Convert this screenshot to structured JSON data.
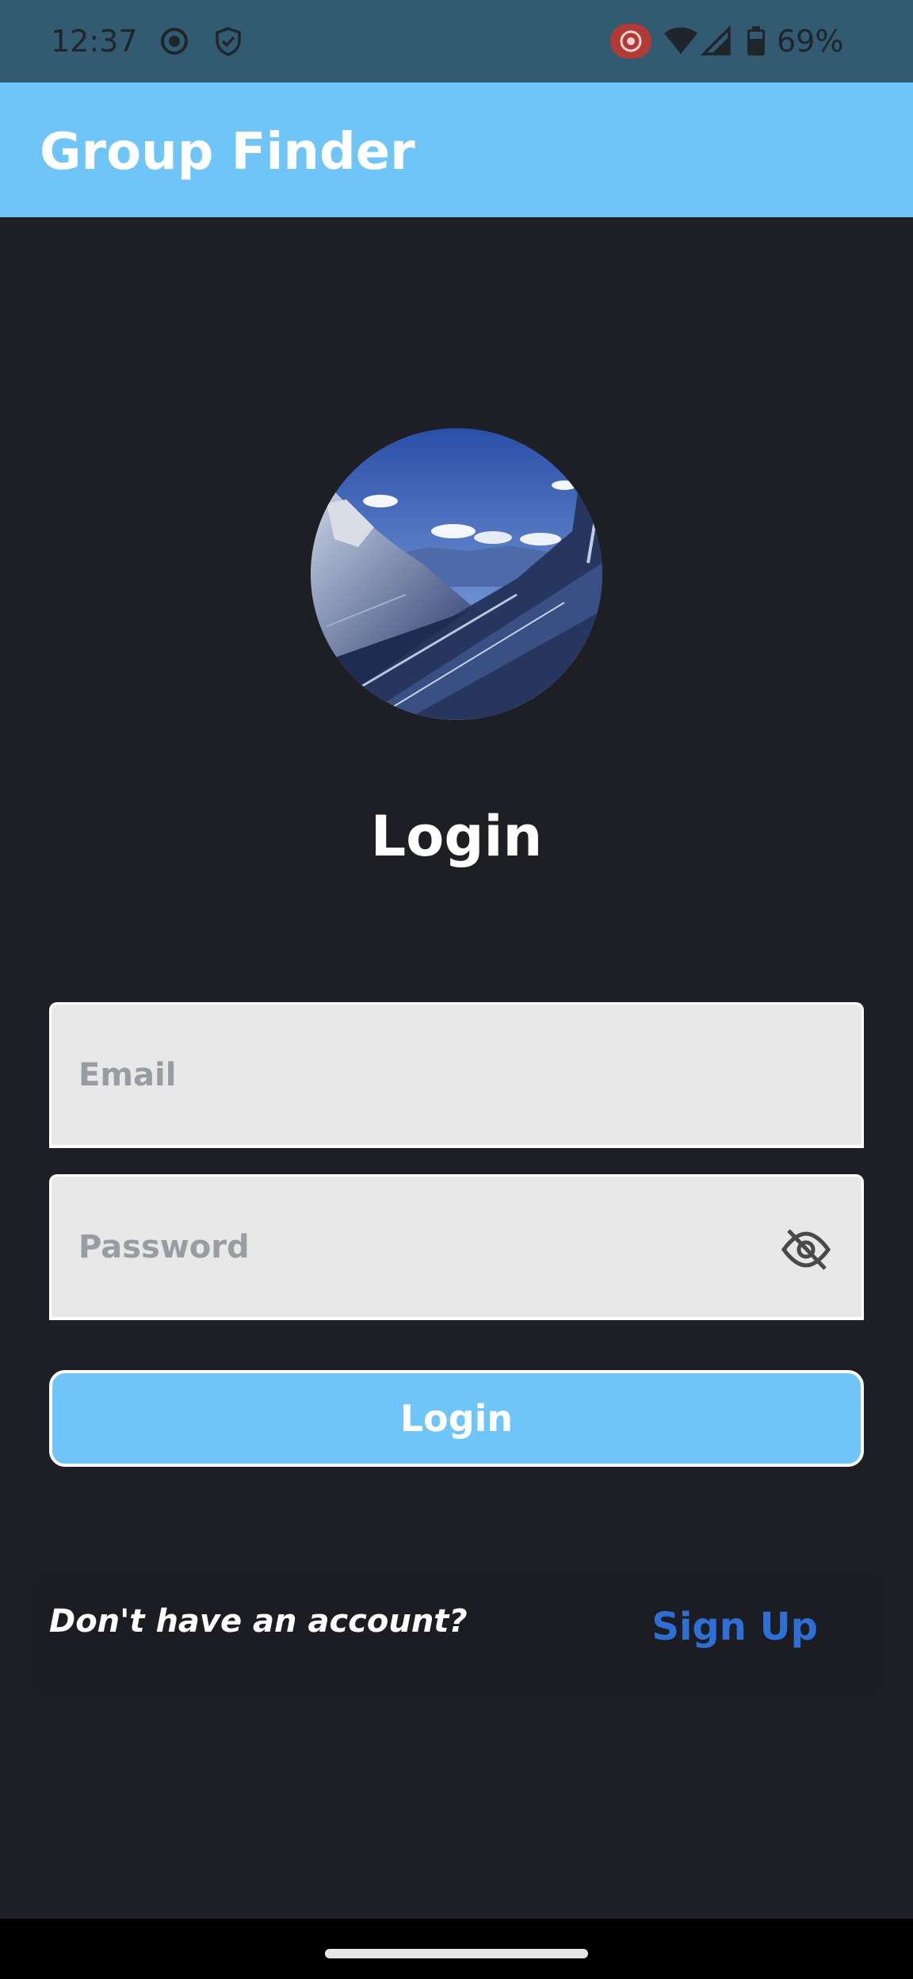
{
  "status_bar": {
    "time": "12:37",
    "battery_percent": "69%",
    "icons": [
      "screen-record-icon",
      "shield-icon",
      "cast-record-icon",
      "wifi-icon",
      "signal-icon",
      "battery-icon"
    ]
  },
  "app_bar": {
    "title": "Group Finder",
    "color": "#70c5f8"
  },
  "avatar": {
    "description_icon": "mountain-landscape-image"
  },
  "login": {
    "heading": "Login",
    "email_placeholder": "Email",
    "password_placeholder": "Password",
    "button_label": "Login"
  },
  "signup": {
    "prompt": "Don't have an account?",
    "link_label": "Sign Up",
    "link_color": "#2f6ed4"
  }
}
